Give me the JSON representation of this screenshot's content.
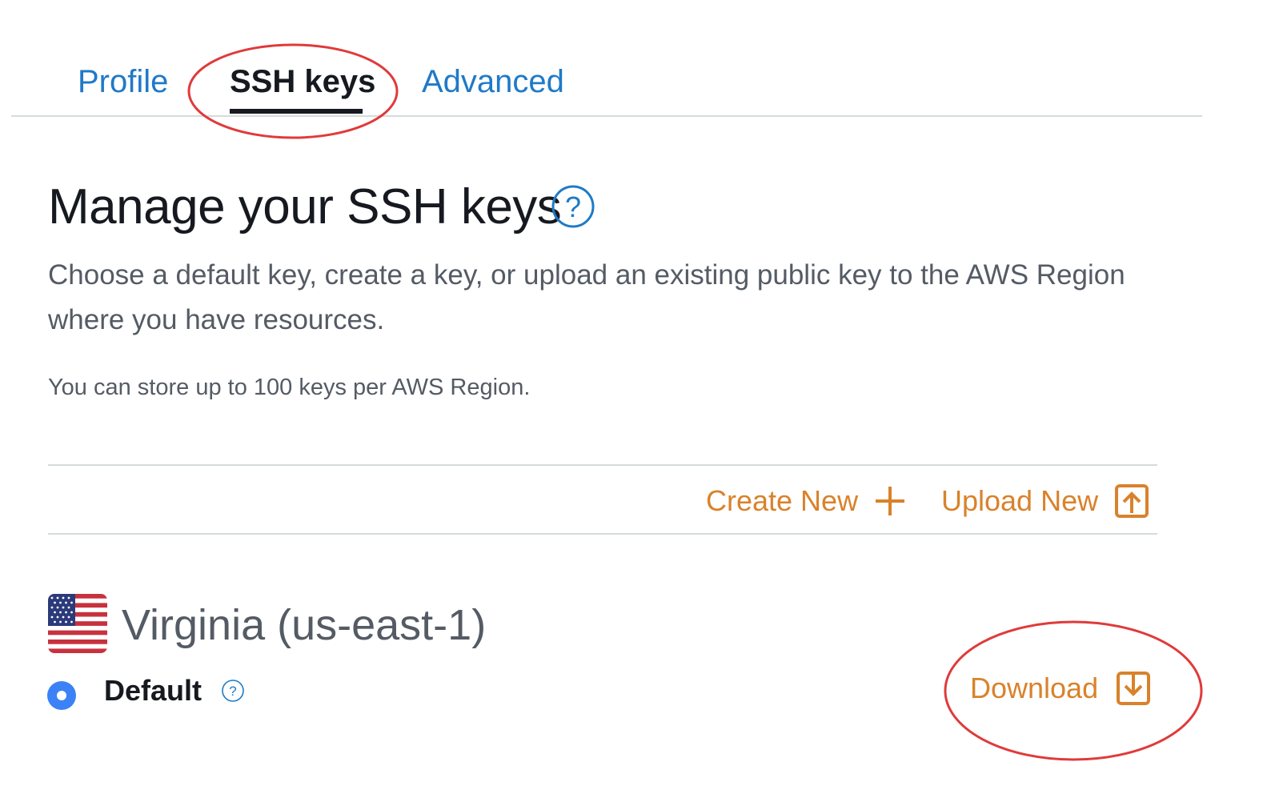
{
  "tabs": [
    {
      "label": "Profile",
      "active": false
    },
    {
      "label": "SSH keys",
      "active": true
    },
    {
      "label": "Advanced",
      "active": false
    }
  ],
  "header": {
    "title": "Manage your SSH keys",
    "help_icon": "help-circle-icon"
  },
  "description": "Choose a default key, create a key, or upload an existing public key to the AWS Region where you have resources.",
  "limit_note": "You can store up to 100 keys per AWS Region.",
  "actions": {
    "create_label": "Create New",
    "create_icon": "plus-icon",
    "upload_label": "Upload New",
    "upload_icon": "upload-icon"
  },
  "region": {
    "flag_icon": "us-flag-icon",
    "name": "Virginia (us-east-1)",
    "keys": [
      {
        "name": "Default",
        "selected": true,
        "help_icon": "help-circle-icon",
        "download_label": "Download",
        "download_icon": "download-icon"
      }
    ]
  },
  "colors": {
    "link_blue": "#1f7ac7",
    "action_orange": "#d9822b",
    "radio_blue": "#3b82f6",
    "annotation_red": "#e03a3a",
    "divider": "#d5dbdb"
  }
}
